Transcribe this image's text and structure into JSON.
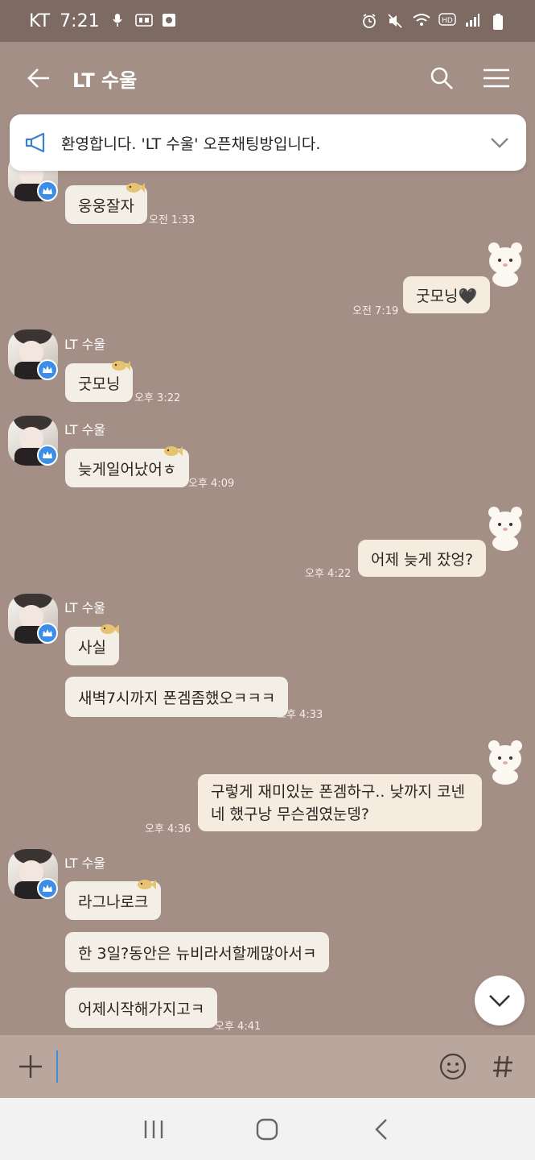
{
  "status_bar": {
    "carrier": "KT",
    "time": "7:21"
  },
  "header": {
    "title": "LT 수울"
  },
  "notice": {
    "text": "환영합니다. 'LT 수울' 오픈채팅방입니다."
  },
  "messages": {
    "m1": {
      "text": "웅웅잘자",
      "time": "오전 1:33"
    },
    "m2": {
      "text": "굿모닝🖤",
      "time": "오전 7:19"
    },
    "m3": {
      "sender": "LT 수울",
      "text": "굿모닝",
      "time": "오후 3:22"
    },
    "m4": {
      "sender": "LT 수울",
      "text": "늦게일어났어ㅎ",
      "time": "오후 4:09"
    },
    "m5": {
      "text": "어제 늦게 잤엉?",
      "time": "오후 4:22"
    },
    "m6": {
      "sender": "LT 수울",
      "text": "사실"
    },
    "m7": {
      "text": "새벽7시까지 폰겜좀했오ㅋㅋㅋ",
      "time": "오후 4:33"
    },
    "m8": {
      "text": "구렇게 재미있눈 폰겜하구.. 낮까지 코넨네 했구낭 무슨겜였눈뎅?",
      "time": "오후 4:36"
    },
    "m9": {
      "sender": "LT 수울",
      "text": "라그나로크"
    },
    "m10": {
      "text": "한 3일?동안은 뉴비라서할께많아서ㅋ"
    },
    "m11": {
      "text": "어제시작해가지고ㅋ",
      "time": "오후 4:41"
    }
  },
  "input": {
    "value": ""
  },
  "colors": {
    "background": "#a48f86",
    "bubble": "#f3efe6",
    "status_bar": "#7d6a63",
    "badge": "#3b8ee8"
  },
  "icons": [
    "back-arrow-icon",
    "search-icon",
    "menu-icon",
    "megaphone-icon",
    "chevron-down-icon",
    "crown-icon",
    "bear-sticker-icon",
    "fish-sticker-icon",
    "plus-icon",
    "emoji-icon",
    "hash-icon",
    "recent-apps-icon",
    "home-icon",
    "back-nav-icon"
  ]
}
